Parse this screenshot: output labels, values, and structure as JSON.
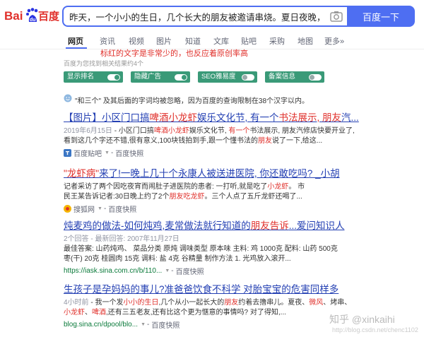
{
  "search": {
    "logo_text": "Bai du 百度",
    "query": "昨天，一个小小的生日，几个长大的朋友被邀请串烧。夏日夜晚，微风",
    "button_label": "百度一下"
  },
  "tabs": [
    "网页",
    "资讯",
    "视频",
    "图片",
    "知道",
    "文库",
    "贴吧",
    "采购",
    "地图",
    "更多»"
  ],
  "annotation_note": "标红的文字是非常少的，也反应着原创率高",
  "result_count": "百度为您找到相关结果约4个",
  "toggles": [
    {
      "label": "显示排名",
      "state": "on"
    },
    {
      "label": "隐藏广告",
      "state": "on"
    },
    {
      "label": "SEO雅易度",
      "state": "off"
    },
    {
      "label": "备案信息",
      "state": "off"
    }
  ],
  "hint": "\"和三个\" 及其后面的字词均被忽略，因为百度的查询限制在38个汉字以内。",
  "results": [
    {
      "title_parts": [
        {
          "t": "【图片】小区门口搞"
        },
        {
          "t": "啤酒小龙虾",
          "red": true
        },
        {
          "t": "娱乐文化节, 有一个"
        },
        {
          "t": "书法展示, 朋友",
          "red": true
        },
        {
          "t": "汽..."
        }
      ],
      "date": "2019年6月15日",
      "lines": [
        [
          {
            "t": " - 小区门口搞"
          },
          {
            "t": "啤酒小龙虾",
            "red": true
          },
          {
            "t": "娱乐文化节, "
          },
          {
            "t": "有一个",
            "red": true
          },
          {
            "t": "书法展示, 朋友汽修店快要开业了,"
          }
        ],
        [
          {
            "t": "看到这几个字还不错,很有意义,100块钱拍到手,跟一个懂书法的"
          },
          {
            "t": "朋友",
            "red": true
          },
          {
            "t": "说了一下,给这..."
          }
        ]
      ],
      "source": "百度贴吧",
      "url": "",
      "cache": "百度快照"
    },
    {
      "title_parts": [
        {
          "t": "\"龙虾病\"",
          "red": true
        },
        {
          "t": "来了!一晚上几十个永康人被送进医院, 你还敢吃吗? _小胡"
        }
      ],
      "date": "",
      "lines": [
        [
          {
            "t": "记者采访了两个因吃夜宵而闹肚子进医院的患者: 一打听,就是吃了"
          },
          {
            "t": "小龙虾",
            "red": true
          },
          {
            "t": "。 市"
          }
        ],
        [
          {
            "t": "民王某告诉记者:30日晚上约了2个"
          },
          {
            "t": "朋友吃龙虾",
            "red": true
          },
          {
            "t": "。三个人点了五斤龙虾还喝了..."
          }
        ]
      ],
      "source": "搜狐网",
      "url": "",
      "cache": "百度快照"
    },
    {
      "title_parts": [
        {
          "t": "炖麦鸡的做法-如何炖鸡,麦常做法就行知道的"
        },
        {
          "t": "朋友告诉",
          "red": true
        },
        {
          "t": "...爱问知识人"
        }
      ],
      "date": "",
      "lines": [
        [
          {
            "t": "2个回答 - 最新回答: 2007年11月27日",
            "grey": true
          }
        ],
        [
          {
            "t": "最佳答案: 山药炖鸡、 菜品分类 原炖 调味类型 原本味 主料: 鸡 1000克 配料: 山药 500克"
          }
        ],
        [
          {
            "t": "枣(干) 20克 桂圆肉 15克 调料: 盐 4克 谷精量 制作方法 1. 光鸡放入滚开..."
          }
        ]
      ],
      "source": "",
      "url": "https://iask.sina.com.cn/b/110...",
      "cache": "百度快照"
    },
    {
      "title_parts": [
        {
          "t": "生孩子是孕妈妈的事儿?准爸爸饮食不科学 对胎宝宝的危害同样多"
        }
      ],
      "date": "4小时前",
      "lines": [
        [
          {
            "t": " - 我一个发"
          },
          {
            "t": "小小的生日",
            "red": true
          },
          {
            "t": ",几个从小一起长大的"
          },
          {
            "t": "朋友",
            "red": true
          },
          {
            "t": "约着去撸串儿。夏夜、"
          },
          {
            "t": "微风",
            "red": true
          },
          {
            "t": "、烤串、"
          }
        ],
        [
          {
            "t": "小龙虾",
            "red": true
          },
          {
            "t": "、"
          },
          {
            "t": "啤酒",
            "red": true
          },
          {
            "t": ",还有三五老友,还有比这个更为惬意的事情吗? 对了得知,..."
          }
        ]
      ],
      "source": "",
      "url": "blog.sina.cn/dpool/blo...",
      "cache": "百度快照"
    }
  ],
  "watermark": {
    "main": "知乎 @xinkaihi",
    "sub": "http://blog.csdn.net/chenc1102"
  }
}
